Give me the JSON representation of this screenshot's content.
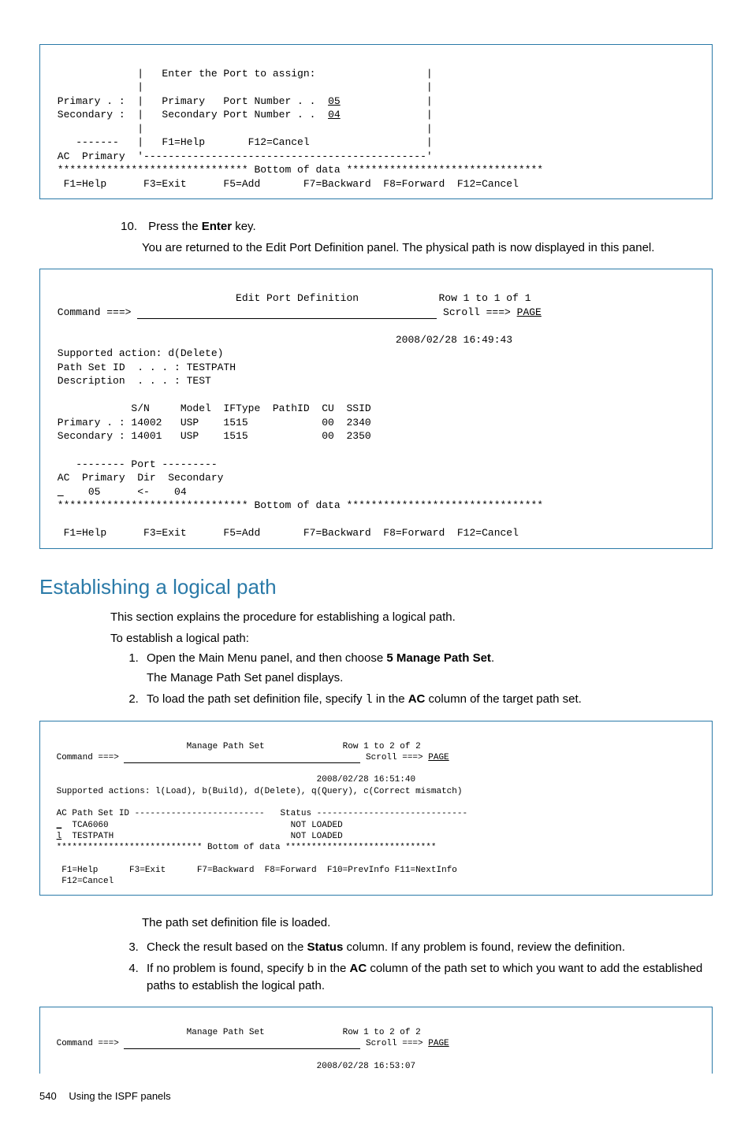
{
  "terminal1": {
    "l1": "              |   Enter the Port to assign:                  |",
    "l2": "              |                                              |",
    "l3a": " Primary . :  |   Primary   Port Number . .  ",
    "l3b": "05",
    "l3c": "              |",
    "l4a": " Secondary :  |   Secondary Port Number . .  ",
    "l4b": "04",
    "l4c": "              |",
    "l5": "              |                                              |",
    "l6": "    -------   |   F1=Help       F12=Cancel                   |",
    "l7": " AC  Primary  '----------------------------------------------'",
    "l8": " ******************************* Bottom of data ********************************",
    "l9": "  F1=Help      F3=Exit      F5=Add       F7=Backward  F8=Forward  F12=Cancel"
  },
  "step10": {
    "num": "10.",
    "text1a": "Press the ",
    "text1b": "Enter",
    "text1c": " key.",
    "text2": "You are returned to the Edit Port Definition panel. The physical path is now displayed in this panel."
  },
  "terminal2": {
    "title": "                              Edit Port Definition             Row 1 to 1 of 1",
    "cmd": " Command ===> ",
    "scroll": " Scroll ===> ",
    "page": "PAGE",
    "ts": "                                                        2008/02/28 16:49:43",
    "l1": " Supported action: d(Delete)",
    "l2": " Path Set ID  . . . : TESTPATH",
    "l3": " Description  . . . : TEST",
    "blank": "",
    "l4": "             S/N     Model  IFType  PathID  CU  SSID",
    "l5": " Primary . : 14002   USP    1515            00  2340",
    "l6": " Secondary : 14001   USP    1515            00  2350",
    "l7": "    -------- Port ---------",
    "l8": " AC  Primary  Dir  Secondary",
    "l9a": " ",
    "l9b": "_",
    "l9c": "    05      <-    04",
    "l10": " ******************************* Bottom of data ********************************",
    "l11": "  F1=Help      F3=Exit      F5=Add       F7=Backward  F8=Forward  F12=Cancel"
  },
  "section": {
    "heading": "Establishing a logical path",
    "intro1": "This section explains the procedure for establishing a logical path.",
    "intro2": "To establish a logical path:",
    "s1a": "Open the Main Menu panel, and then choose ",
    "s1b": "5 Manage Path Set",
    "s1c": ".",
    "s1sub": "The Manage Path Set panel displays.",
    "s2a": "To load the path set definition file, specify ",
    "s2b": "l",
    "s2c": " in the ",
    "s2d": "AC",
    "s2e": " column of the target path set."
  },
  "terminal3": {
    "title": "                          Manage Path Set               Row 1 to 2 of 2",
    "cmd": " Command ===> ",
    "scroll": " Scroll ===> ",
    "page": "PAGE",
    "ts": "                                                   2008/02/28 16:51:40",
    "l1": " Supported actions: l(Load), b(Build), d(Delete), q(Query), c(Correct mismatch)",
    "blank": "",
    "l2": " AC Path Set ID -------------------------   Status -----------------------------",
    "l3a": " ",
    "l3b": "_",
    "l3c": "  TCA6060                                   NOT LOADED",
    "l4a": " ",
    "l4b": "l",
    "l4c": "  TESTPATH                                  NOT LOADED",
    "l5": " **************************** Bottom of data *****************************",
    "l6": "  F1=Help      F3=Exit      F7=Backward  F8=Forward  F10=PrevInfo F11=NextInfo",
    "l7": "  F12=Cancel"
  },
  "after_t3": {
    "loaded": "The path set definition file is loaded.",
    "s3a": "Check the result based on the ",
    "s3b": "Status",
    "s3c": " column. If any problem is found, review the definition.",
    "s4a": "If no problem is found, specify ",
    "s4b": "b",
    "s4c": " in the ",
    "s4d": "AC",
    "s4e": " column of the path set to which you want to add the established paths to establish the logical path."
  },
  "terminal4": {
    "title": "                          Manage Path Set               Row 1 to 2 of 2",
    "cmd": " Command ===> ",
    "scroll": " Scroll ===> ",
    "page": "PAGE",
    "ts": "                                                   2008/02/28 16:53:07"
  },
  "footer": {
    "page": "540",
    "label": "Using the ISPF panels"
  }
}
